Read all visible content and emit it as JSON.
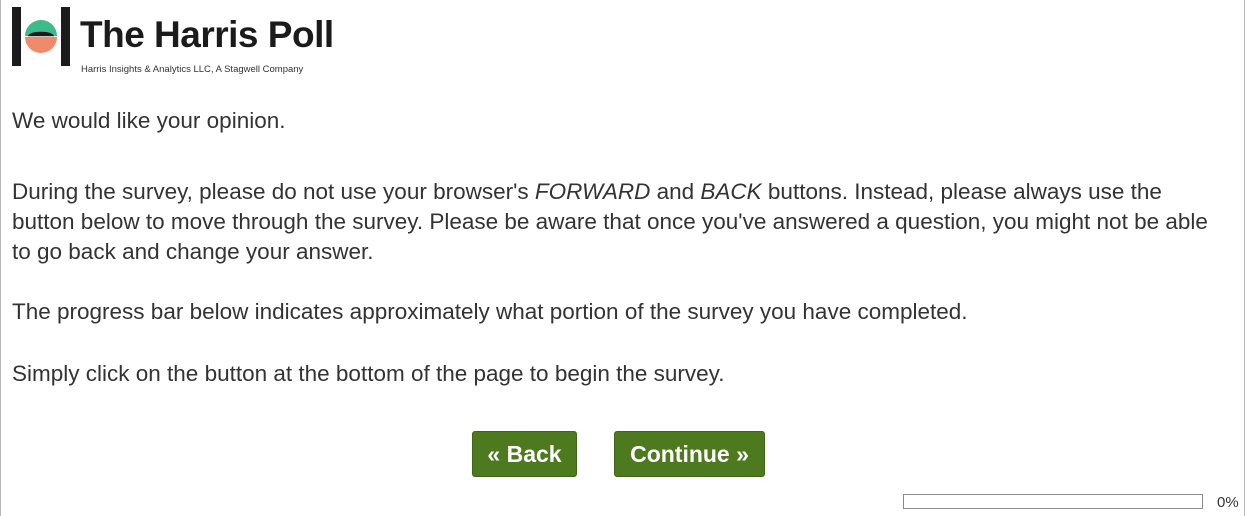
{
  "brand": {
    "name": "The Harris Poll",
    "subtitle": "Harris Insights & Analytics LLC, A Stagwell Company",
    "logo_icon": "harris-poll-logo-icon",
    "colors": {
      "teal": "#3dbb8a",
      "coral": "#f08a6b",
      "dark": "#1b1b1b"
    }
  },
  "intro": {
    "greeting": "We would like your opinion.",
    "instructions_part1": "During the survey, please do not use your browser's ",
    "forward_word": "FORWARD",
    "instructions_and": " and ",
    "back_word": "BACK",
    "instructions_part2": " buttons. Instead, please always use the button below to move through the survey. Please be aware that once you've answered a question, you might not be able to go back and change your answer.",
    "progress_note": "The progress bar below indicates approximately what portion of the survey you have completed.",
    "begin_note": "Simply click on the button at the bottom of the page to begin the survey."
  },
  "navigation": {
    "back_label": "« Back",
    "continue_label": "Continue »",
    "button_color": "#4d7a1e"
  },
  "progress": {
    "percent": 0,
    "label": "0%"
  }
}
